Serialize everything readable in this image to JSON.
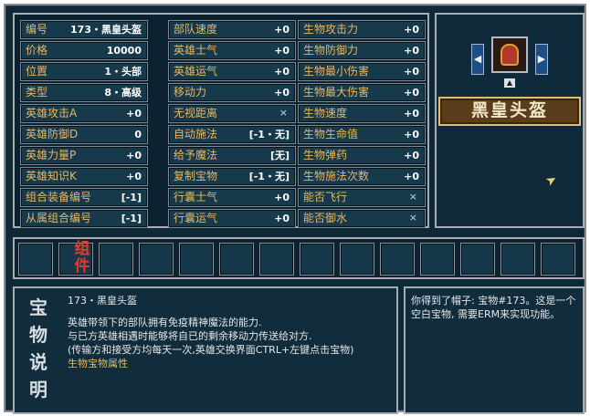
{
  "grid": {
    "col1": [
      {
        "label": "编号",
        "value": "173・黑皇头盔"
      },
      {
        "label": "价格",
        "value": "10000"
      },
      {
        "label": "位置",
        "value": "1・头部"
      },
      {
        "label": "类型",
        "value": "8・高级"
      },
      {
        "label": "英雄攻击A",
        "value": "+0"
      },
      {
        "label": "英雄防御D",
        "value": "0"
      },
      {
        "label": "英雄力量P",
        "value": "+0"
      },
      {
        "label": "英雄知识K",
        "value": "+0"
      },
      {
        "label": "组合装备编号",
        "value": "[-1]"
      },
      {
        "label": "从属组合编号",
        "value": "[-1]"
      }
    ],
    "col2": [
      {
        "label": "部队速度",
        "value": "+0"
      },
      {
        "label": "英雄士气",
        "value": "+0"
      },
      {
        "label": "英雄运气",
        "value": "+0"
      },
      {
        "label": "移动力",
        "value": "+0"
      },
      {
        "label": "无视距离",
        "value": "×"
      },
      {
        "label": "自动施法",
        "value": "[-1・无]"
      },
      {
        "label": "给予魔法",
        "value": "[无]"
      },
      {
        "label": "复制宝物",
        "value": "[-1・无]"
      },
      {
        "label": "行囊士气",
        "value": "+0"
      },
      {
        "label": "行囊运气",
        "value": "+0"
      }
    ],
    "col3": [
      {
        "label": "生物攻击力",
        "value": "+0"
      },
      {
        "label": "生物防御力",
        "value": "+0"
      },
      {
        "label": "生物最小伤害",
        "value": "+0"
      },
      {
        "label": "生物最大伤害",
        "value": "+0"
      },
      {
        "label": "生物速度",
        "value": "+0"
      },
      {
        "label": "生物生命值",
        "value": "+0"
      },
      {
        "label": "生物弹药",
        "value": "+0"
      },
      {
        "label": "生物施法次数",
        "value": "+0"
      },
      {
        "label": "能否飞行",
        "value": "×"
      },
      {
        "label": "能否御水",
        "value": "×"
      }
    ]
  },
  "hero": {
    "name": "黑皇头盔",
    "left_arrow": "◀",
    "right_arrow": "▶",
    "up_arrow": "▲"
  },
  "slots": {
    "count": 14,
    "combo_tag": "组件"
  },
  "description": {
    "title_chars": [
      "宝",
      "物",
      "说",
      "明"
    ],
    "heading": "173・黑皇头盔",
    "line1": "英雄带领下的部队拥有免疫精神魔法的能力.",
    "line2": "与已方英雄相遇时能够将自已的剩余移动力传送给对方.",
    "line3": "(传输方和接受方均每天一次,英雄交换界面CTRL+左键点击宝物)",
    "line4": "生物宝物属性"
  },
  "message": {
    "text": "你得到了帽子: 宝物#173。这是一个空白宝物, 需要ERM来实现功能。"
  }
}
